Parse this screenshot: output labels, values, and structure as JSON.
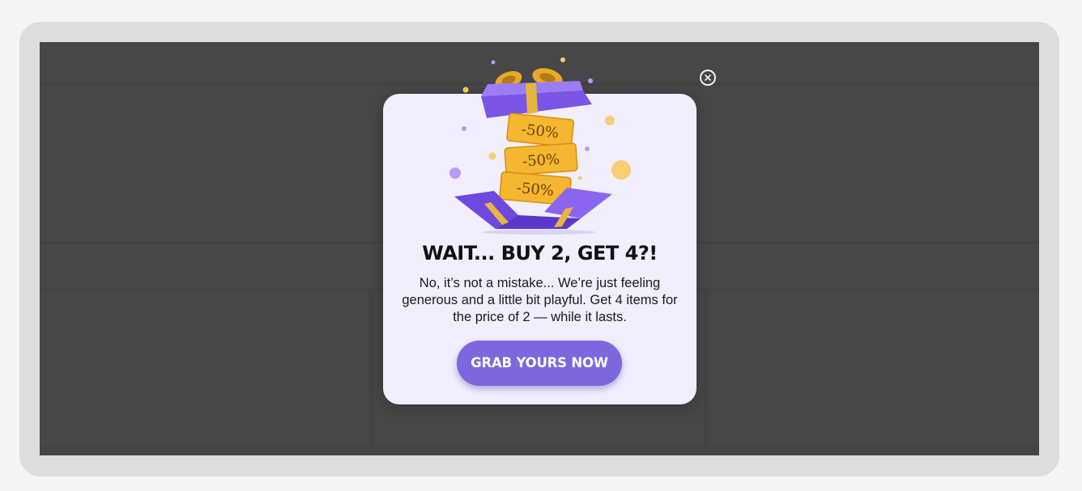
{
  "popup": {
    "headline": "WAIT... BUY 2, GET 4?!",
    "body": "No, it’s not a mistake... We’re just feeling generous and a little bit playful. Get 4 items for the price of 2 — while it lasts.",
    "cta_label": "GRAB YOURS NOW",
    "coupon_labels": [
      "-50%",
      "-50%",
      "-50%"
    ]
  },
  "icons": {
    "close": "close-icon",
    "gift": "gift-box-illustration"
  },
  "colors": {
    "accent": "#7d67dd",
    "popup_background": "#f1eefe",
    "overlay": "#474747",
    "coupon_gold": "#f5b731",
    "gift_purple": "#8b6cf0"
  }
}
